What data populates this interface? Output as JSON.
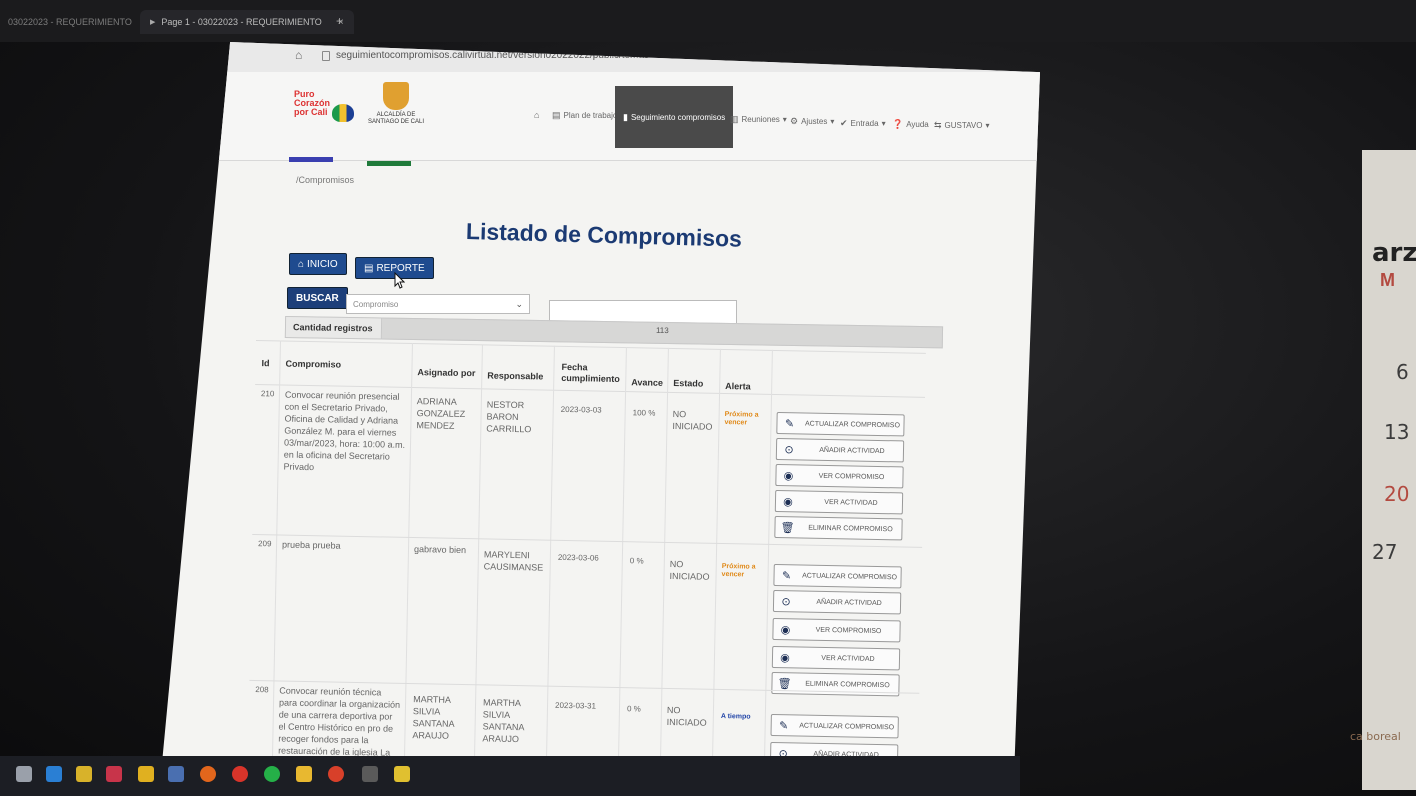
{
  "tabs": {
    "inactive": "03022023 - REQUERIMIENTO",
    "active": "Page 1 - 03022023 - REQUERIMIENTO",
    "close": "×",
    "new": "+"
  },
  "browser": {
    "url": "seguimientocompromisos.calivirtual.net/version02022022/public/temas"
  },
  "logos": {
    "brand1": "Puro Corazón por Cali",
    "brand2": "ALCALDÍA DE SANTIAGO DE CALI"
  },
  "nav": {
    "items": [
      {
        "label": "",
        "icon": "home-icon"
      },
      {
        "label": "Plan de trabajo",
        "icon": "table-icon"
      },
      {
        "label": "Seguimiento compromisos",
        "icon": "bookmark-icon"
      },
      {
        "label": "Reuniones",
        "icon": "chart-icon"
      },
      {
        "label": "Ajustes",
        "icon": "gear-icon"
      },
      {
        "label": "Entrada",
        "icon": "check-icon"
      },
      {
        "label": "Ayuda",
        "icon": "question-icon"
      },
      {
        "label": "GUSTAVO",
        "icon": "arrows-icon"
      }
    ]
  },
  "breadcrumb": "/Compromisos",
  "page_title": "Listado de Compromisos",
  "buttons": {
    "inicio": "INICIO",
    "reporte": "REPORTE",
    "buscar": "BUSCAR"
  },
  "search": {
    "select_value": "Compromiso"
  },
  "count": {
    "label": "Cantidad registros",
    "value": "113"
  },
  "table": {
    "headers": [
      "Id",
      "Compromiso",
      "Asignado por",
      "Responsable",
      "Fecha cumplimiento",
      "Avance",
      "Estado",
      "Alerta"
    ],
    "actions": [
      "ACTUALIZAR COMPROMISO",
      "AÑADIR ACTIVIDAD",
      "VER COMPROMISO",
      "VER ACTIVIDAD",
      "ELIMINAR COMPROMISO"
    ],
    "rows": [
      {
        "id": "210",
        "compromiso": "Convocar reunión presencial con el Secretario Privado, Oficina de Calidad y Adriana González M. para el viernes 03/mar/2023, hora: 10:00 a.m. en la oficina del Secretario Privado",
        "asignado": "ADRIANA GONZALEZ MENDEZ",
        "responsable": "NESTOR BARON CARRILLO",
        "fecha": "2023-03-03",
        "avance": "100 %",
        "estado": "NO INICIADO",
        "alerta": "Próximo a vencer"
      },
      {
        "id": "209",
        "compromiso": "prueba prueba",
        "asignado": "gabravo bien",
        "responsable": "MARYLENI CAUSIMANSE",
        "fecha": "2023-03-06",
        "avance": "0 %",
        "estado": "NO INICIADO",
        "alerta": "Próximo a vencer"
      },
      {
        "id": "208",
        "compromiso": "Convocar reunión técnica para coordinar la organización de una carrera deportiva por el Centro Histórico en pro de recoger fondos para la restauración de la iglesia La Ermita",
        "asignado": "MARTHA SILVIA SANTANA ARAUJO",
        "responsable": "MARTHA SILVIA SANTANA ARAUJO",
        "fecha": "2023-03-31",
        "avance": "0 %",
        "estado": "NO INICIADO",
        "alerta": "A tiempo"
      }
    ]
  },
  "calendar": {
    "header": "arzo",
    "month_code": "M",
    "days": [
      "6",
      "13",
      "20",
      "27"
    ],
    "note": "ca boreal"
  },
  "colors": {
    "brand_blue": "#1f4b8f",
    "title_blue": "#1b3a73",
    "alert_orange": "#e08a1a",
    "alert_blue": "#2346a8",
    "nav_active": "#4a4a4a"
  }
}
